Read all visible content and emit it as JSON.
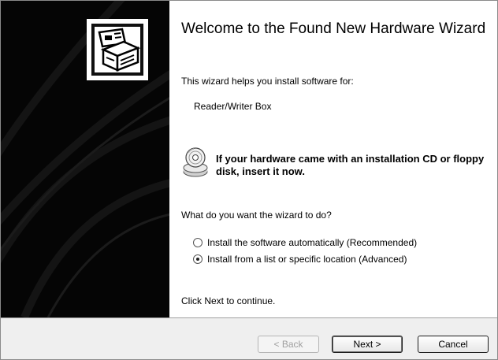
{
  "wizard": {
    "title": "Welcome to the Found New Hardware Wizard",
    "intro": "This wizard helps you install software for:",
    "device_name": "Reader/Writer Box",
    "cd_prompt": "If your hardware came with an installation CD or floppy disk, insert it now.",
    "question": "What do you want the wizard to do?",
    "options": [
      {
        "label": "Install the software automatically (Recommended)",
        "selected": false
      },
      {
        "label": "Install from a list or specific location (Advanced)",
        "selected": true
      }
    ],
    "footer_text": "Click Next to continue."
  },
  "buttons": {
    "back_label": "< Back",
    "back_enabled": false,
    "next_label": "Next >",
    "cancel_label": "Cancel"
  },
  "icons": {
    "banner": "hardware-wizard-icon",
    "cd": "cd-drive-icon"
  },
  "colors": {
    "left_panel": "#050505",
    "content_bg": "#ffffff",
    "button_bar": "#efefef"
  }
}
